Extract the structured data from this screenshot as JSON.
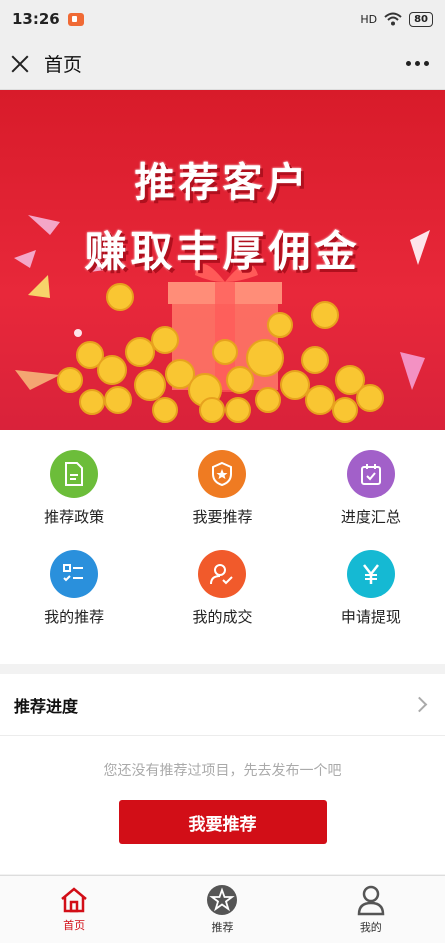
{
  "status_bar": {
    "time": "13:26",
    "network": "HD",
    "battery": "80"
  },
  "navbar": {
    "title": "首页"
  },
  "banner": {
    "line1": "推荐客户",
    "line2": "赚取丰厚佣金"
  },
  "menu": [
    {
      "label": "推荐政策",
      "icon": "document-icon",
      "color": "#6cbd3a"
    },
    {
      "label": "我要推荐",
      "icon": "shield-star-icon",
      "color": "#ef7b22"
    },
    {
      "label": "进度汇总",
      "icon": "calendar-check-icon",
      "color": "#a260c9"
    },
    {
      "label": "我的推荐",
      "icon": "checklist-icon",
      "color": "#2a90dc"
    },
    {
      "label": "我的成交",
      "icon": "user-check-icon",
      "color": "#f15a2b"
    },
    {
      "label": "申请提现",
      "icon": "yen-icon",
      "color": "#15b9d3"
    }
  ],
  "progress": {
    "title": "推荐进度",
    "empty_text": "您还没有推荐过项目，先去发布一个吧",
    "button_label": "我要推荐"
  },
  "tabbar": {
    "items": [
      {
        "label": "首页",
        "icon": "home-icon",
        "active": true
      },
      {
        "label": "推荐",
        "icon": "star-icon",
        "active": false
      },
      {
        "label": "我的",
        "icon": "person-icon",
        "active": false
      }
    ],
    "active_color": "#d20e17"
  }
}
